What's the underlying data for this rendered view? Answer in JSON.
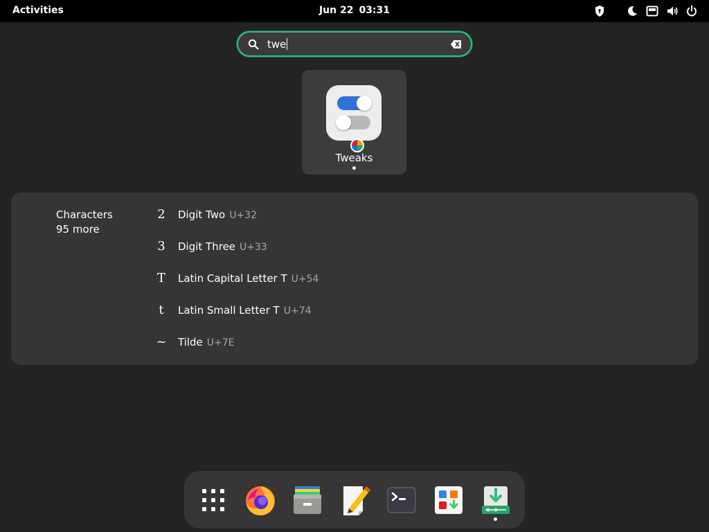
{
  "topbar": {
    "activities_label": "Activities",
    "date": "Jun 22",
    "time": "03:31",
    "icons": [
      "privacy-shield-icon",
      "night-light-icon",
      "network-wired-icon",
      "volume-icon",
      "power-icon"
    ]
  },
  "search": {
    "query": "twe",
    "icon": "search-icon",
    "clear_icon": "clear-text-icon"
  },
  "app_results": [
    {
      "name": "Tweaks",
      "icon": "tweaks-app-icon"
    }
  ],
  "characters": {
    "title": "Characters",
    "more": "95 more",
    "items": [
      {
        "glyph": "2",
        "name": "Digit Two",
        "code": "U+32"
      },
      {
        "glyph": "3",
        "name": "Digit Three",
        "code": "U+33"
      },
      {
        "glyph": "T",
        "name": "Latin Capital Letter T",
        "code": "U+54"
      },
      {
        "glyph": "t",
        "name": "Latin Small Letter T",
        "code": "U+74"
      },
      {
        "glyph": "~",
        "name": "Tilde",
        "code": "U+7E"
      }
    ]
  },
  "dash": {
    "items": [
      {
        "name": "show-apps-icon"
      },
      {
        "name": "firefox-icon"
      },
      {
        "name": "files-icon"
      },
      {
        "name": "text-editor-icon"
      },
      {
        "name": "terminal-icon"
      },
      {
        "name": "software-icon"
      },
      {
        "name": "installer-icon"
      }
    ]
  },
  "colors": {
    "accent": "#2ec27e",
    "background": "#232323",
    "topbar": "#000000",
    "panel": "#353535",
    "secondary_text": "#a6a6a6"
  }
}
